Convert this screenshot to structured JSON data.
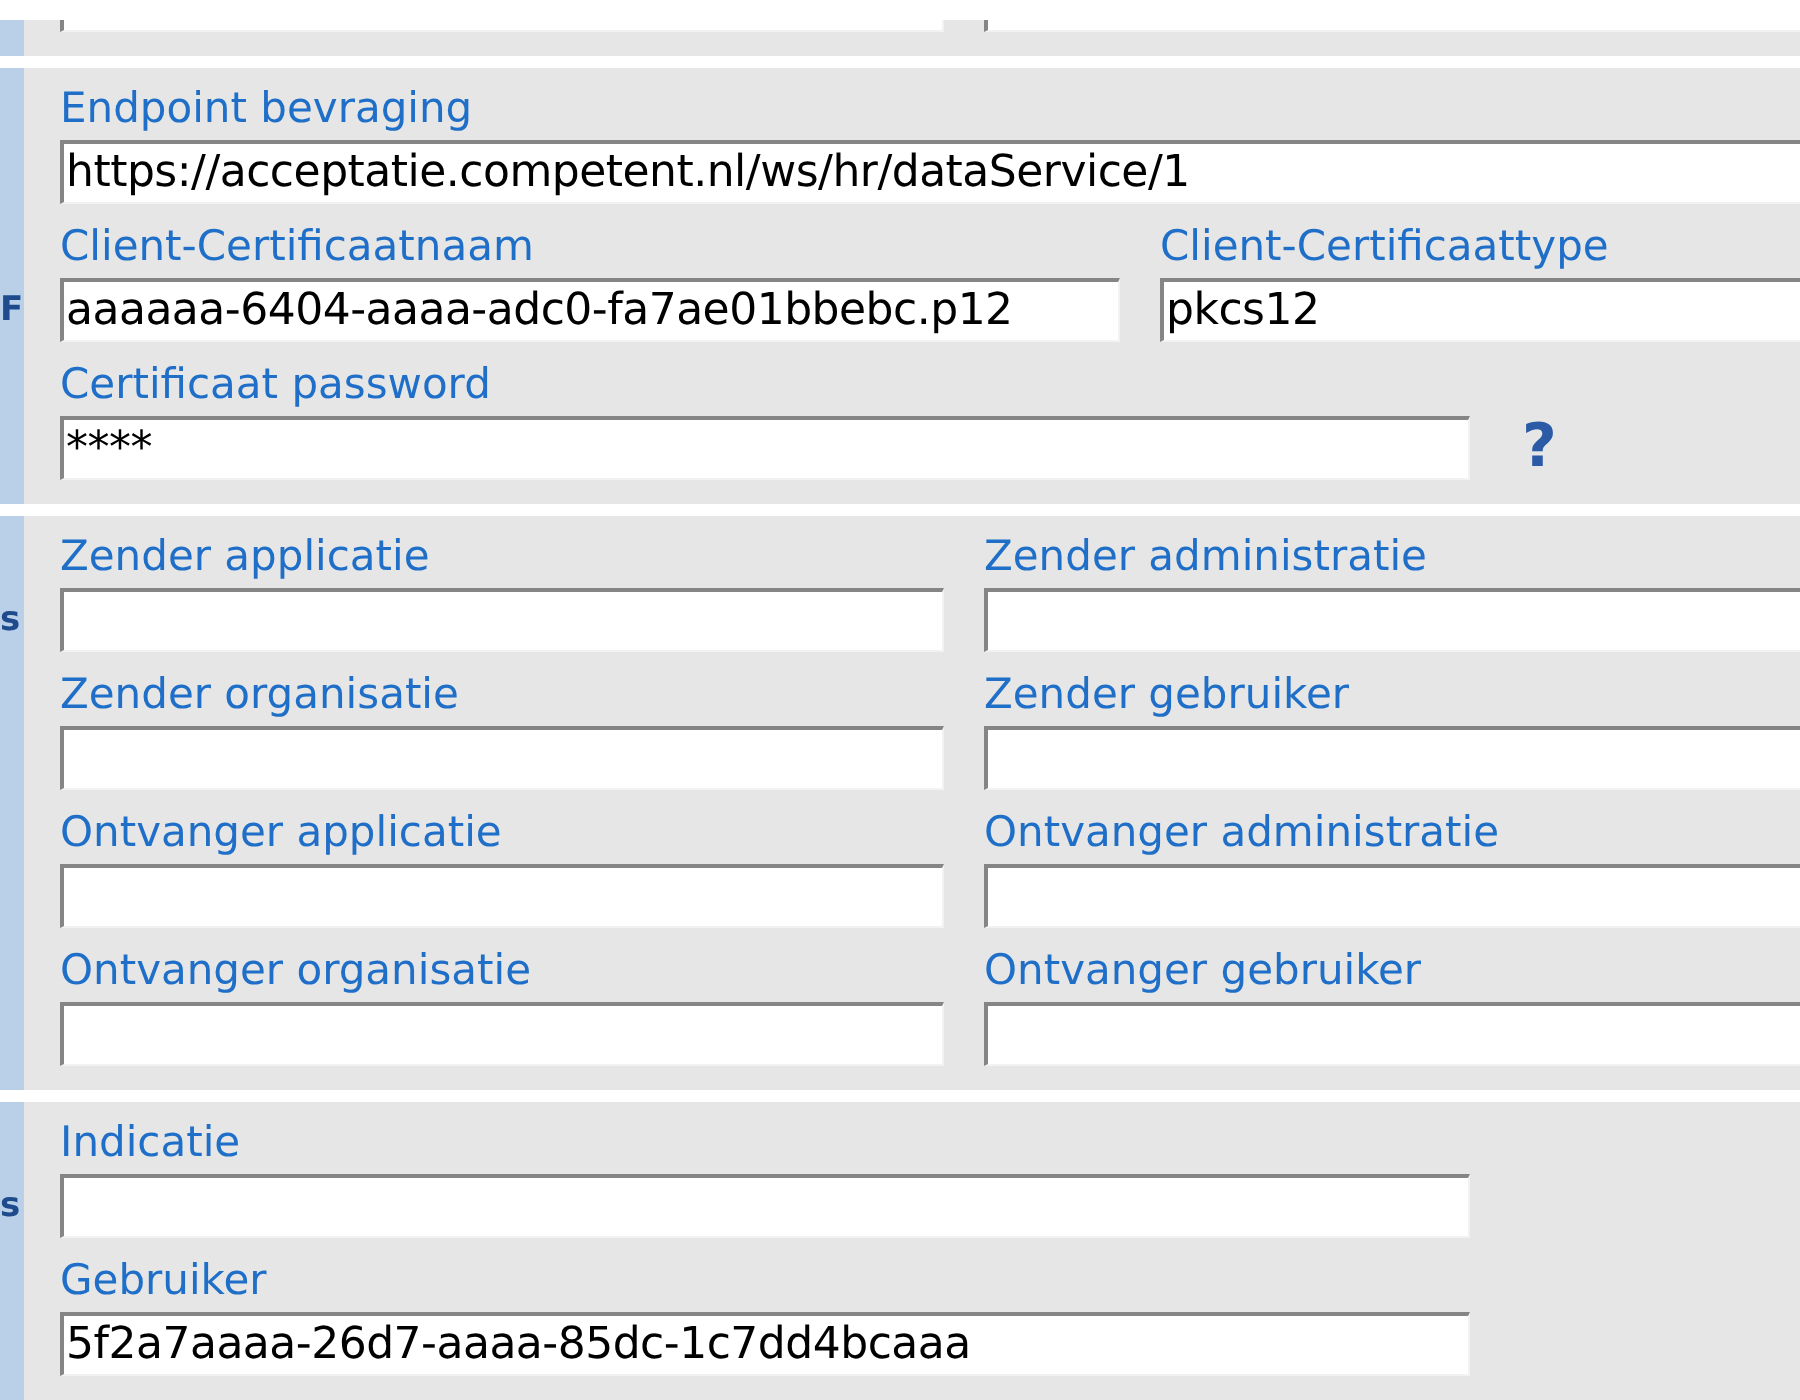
{
  "sections": [
    {
      "rows": [
        {
          "fields": [
            {
              "cut_off": true
            },
            {
              "cut_off": true
            }
          ]
        }
      ]
    },
    {
      "rows": [
        {
          "fields": [
            {
              "label": "Endpoint bevraging",
              "value": "https://acceptatie.competent.nl/ws/hr/dataService/1"
            }
          ]
        },
        {
          "side_label": "F",
          "fields": [
            {
              "label": "Client-Certificaatnaam",
              "value": "aaaaaa-6404-aaaa-adc0-fa7ae01bbebc.p12"
            },
            {
              "label": "Client-Certificaattype",
              "value": "pkcs12"
            }
          ]
        },
        {
          "fields": [
            {
              "label": "Certificaat password",
              "value": "****",
              "help": "?"
            }
          ]
        }
      ]
    },
    {
      "rows": [
        {
          "side_label": "s",
          "fields": [
            {
              "label": "Zender applicatie"
            },
            {
              "label": "Zender administratie"
            }
          ]
        },
        {
          "fields": [
            {
              "label": "Zender organisatie"
            },
            {
              "label": "Zender gebruiker"
            }
          ]
        },
        {
          "fields": [
            {
              "label": "Ontvanger applicatie"
            },
            {
              "label": "Ontvanger administratie"
            }
          ]
        },
        {
          "fields": [
            {
              "label": "Ontvanger organisatie"
            },
            {
              "label": "Ontvanger gebruiker"
            }
          ]
        }
      ]
    },
    {
      "rows": [
        {
          "side_label": "s",
          "fields": [
            {
              "label": "Indicatie"
            }
          ]
        },
        {
          "fields": [
            {
              "label": "Gebruiker",
              "value": "5f2a7aaaa-26d7-aaaa-85dc-1c7dd4bcaaa"
            }
          ]
        }
      ]
    }
  ]
}
